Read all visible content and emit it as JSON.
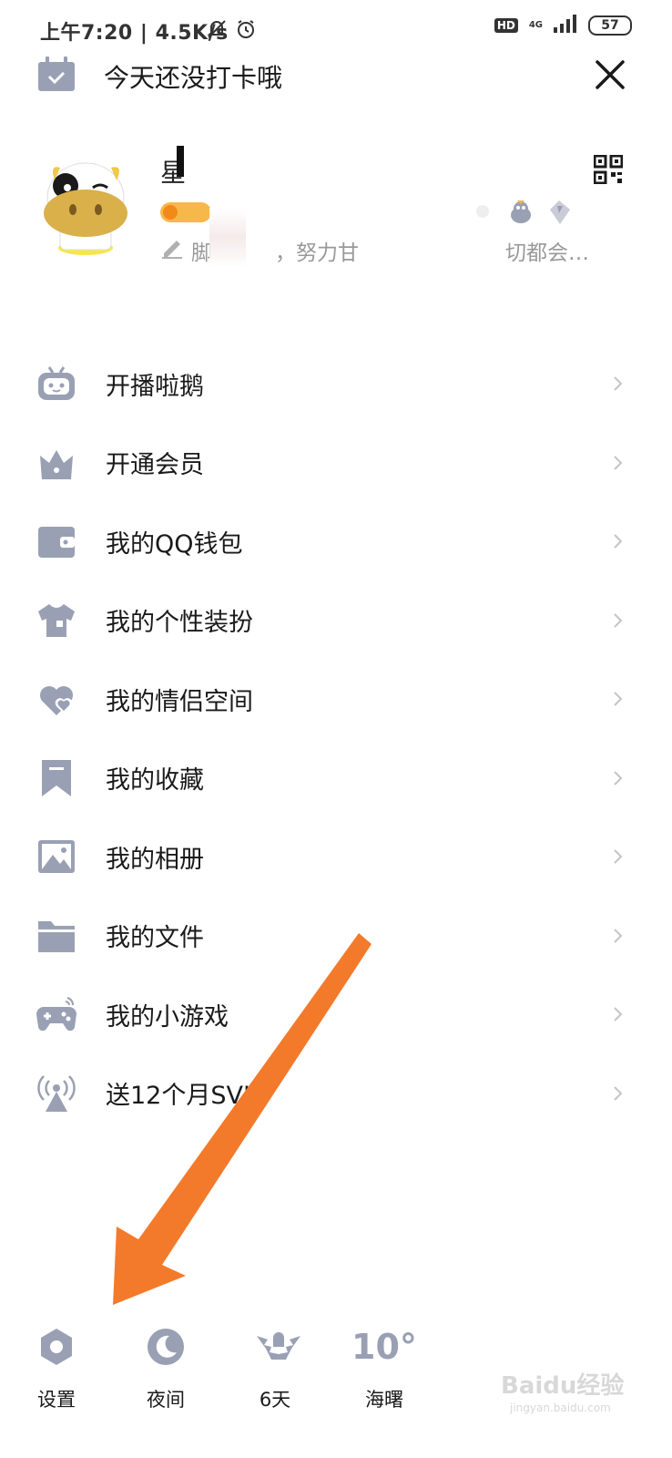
{
  "status_bar": {
    "time_speed": "上午7:20 | 4.5K/s",
    "hd": "HD",
    "network": "4G",
    "battery": "57"
  },
  "header": {
    "checkin_text": "今天还没打卡哦"
  },
  "profile": {
    "nickname": "星",
    "signature": "脚　　　，努力甘　　　　　　　切都会…"
  },
  "menu": [
    {
      "label": "开播啦鹅",
      "icon": "tv-robot-icon"
    },
    {
      "label": "开通会员",
      "icon": "crown-icon"
    },
    {
      "label": "我的QQ钱包",
      "icon": "wallet-icon"
    },
    {
      "label": "我的个性装扮",
      "icon": "tshirt-icon"
    },
    {
      "label": "我的情侣空间",
      "icon": "hearts-icon"
    },
    {
      "label": "我的收藏",
      "icon": "bookmark-icon"
    },
    {
      "label": "我的相册",
      "icon": "photo-icon"
    },
    {
      "label": "我的文件",
      "icon": "folder-icon"
    },
    {
      "label": "我的小游戏",
      "icon": "gamepad-icon"
    },
    {
      "label": "送12个月SVI",
      "icon": "broadcast-icon"
    }
  ],
  "bottom": {
    "settings": "设置",
    "night": "夜间",
    "days": "6天",
    "temperature": "10°",
    "city": "海曙"
  },
  "watermark": "Baidu经验",
  "watermark_sub": "jingyan.baidu.com",
  "colors": {
    "icon_gray": "#9aa0b4",
    "arrow_orange": "#f47a2b"
  }
}
